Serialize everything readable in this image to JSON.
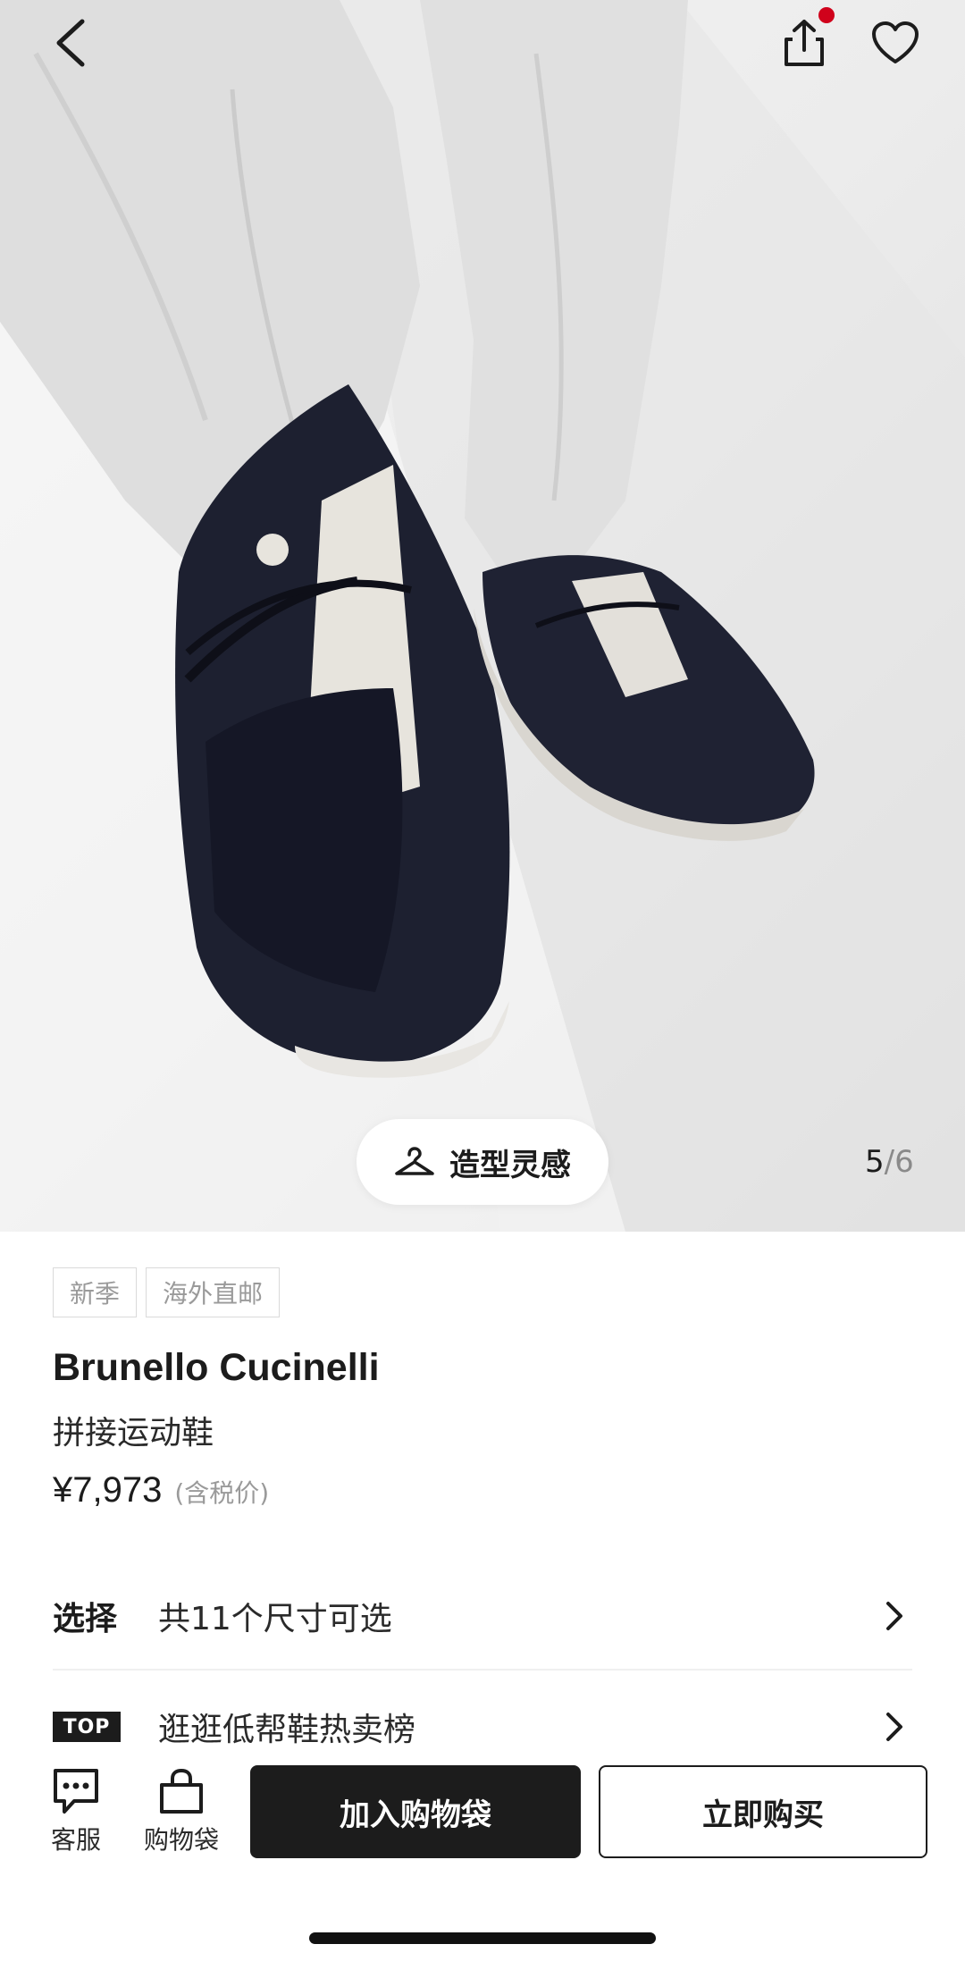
{
  "header": {
    "back_icon": "chevron-left-icon",
    "share_icon": "share-icon",
    "favorite_icon": "heart-icon",
    "share_dot_color": "#d0021b"
  },
  "gallery": {
    "inspiration_label": "造型灵感",
    "inspiration_icon": "hanger-icon",
    "current_page": "5",
    "separator": "/",
    "total_pages": "6"
  },
  "product": {
    "tags": [
      "新季",
      "海外直邮"
    ],
    "brand": "Brunello Cucinelli",
    "name": "拼接运动鞋",
    "price": "¥7,973",
    "price_note": "(含税价)"
  },
  "options": {
    "select_label": "选择",
    "select_text": "共11个尺寸可选",
    "top_badge": "TOP",
    "ranking_text": "逛逛低帮鞋热卖榜"
  },
  "bottom_bar": {
    "service_label": "客服",
    "service_icon": "chat-icon",
    "bag_label": "购物袋",
    "bag_icon": "bag-icon",
    "add_to_bag": "加入购物袋",
    "buy_now": "立即购买"
  }
}
